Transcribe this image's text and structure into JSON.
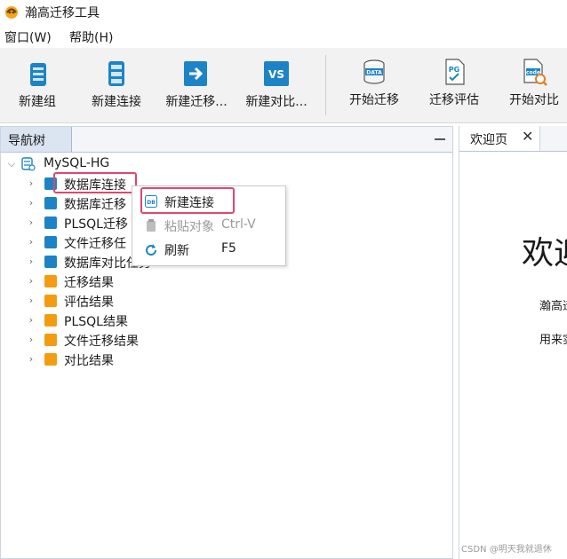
{
  "window": {
    "title": "瀚高迁移工具"
  },
  "menubar": {
    "items": [
      "窗口(W)",
      "帮助(H)"
    ]
  },
  "toolbar": {
    "buttons": [
      {
        "label": "新建组",
        "icon": "server-group-icon"
      },
      {
        "label": "新建连接",
        "icon": "server-icon"
      },
      {
        "label": "新建迁移...",
        "icon": "migration-arrow-icon"
      },
      {
        "label": "新建对比...",
        "icon": "vs-icon"
      },
      {
        "label": "开始迁移",
        "icon": "data-database-icon"
      },
      {
        "label": "迁移评估",
        "icon": "pg-document-icon"
      },
      {
        "label": "开始对比",
        "icon": "code-compare-icon"
      }
    ]
  },
  "nav": {
    "tab_label": "导航树",
    "root": {
      "label": "MySQL-HG",
      "icon": "database-connection-icon"
    },
    "children": [
      {
        "label": "数据库连接",
        "icon": "db-connection-icon"
      },
      {
        "label": "数据库迁移",
        "icon": "migration-icon"
      },
      {
        "label": "PLSQL迁移",
        "icon": "plsql-icon"
      },
      {
        "label": "文件迁移任",
        "icon": "file-icon"
      },
      {
        "label": "数据库对比任务",
        "icon": "vs-icon"
      },
      {
        "label": "迁移结果",
        "icon": "folder-icon"
      },
      {
        "label": "评估结果",
        "icon": "folder-icon"
      },
      {
        "label": "PLSQL结果",
        "icon": "folder-icon"
      },
      {
        "label": "文件迁移结果",
        "icon": "folder-icon"
      },
      {
        "label": "对比结果",
        "icon": "folder-icon"
      }
    ]
  },
  "context_menu": {
    "items": [
      {
        "label": "新建连接",
        "shortcut": "",
        "icon": "new-connection-icon",
        "enabled": true
      },
      {
        "label": "粘贴对象",
        "shortcut": "Ctrl-V",
        "icon": "paste-icon",
        "enabled": false
      },
      {
        "label": "刷新",
        "shortcut": "F5",
        "icon": "refresh-icon",
        "enabled": true
      }
    ]
  },
  "welcome": {
    "tab_label": "欢迎页",
    "close_glyph": "✕",
    "heading": "欢迎",
    "line1": "瀚高迁",
    "line2": "用来实"
  },
  "watermark": "CSDN @明天我就退休",
  "colors": {
    "highlight_border": "#e0476b",
    "icon_blue": "#1c84c6",
    "folder_orange": "#f39c12"
  }
}
